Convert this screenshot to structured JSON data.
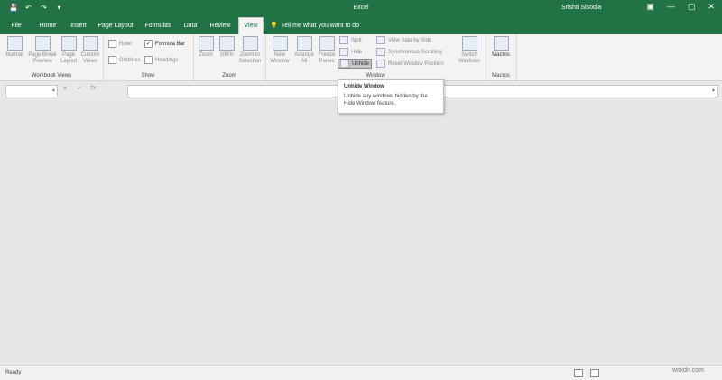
{
  "titlebar": {
    "title": "Excel",
    "user": "Srishti Sisodia",
    "qat": {
      "save": "💾",
      "undo": "↶",
      "redo": "↷",
      "more": "▾"
    },
    "window_buttons": {
      "ribbon_options": "▣",
      "minimize": "—",
      "maximize": "▢",
      "close": "✕"
    }
  },
  "tabs": [
    "File",
    "Home",
    "Insert",
    "Page Layout",
    "Formulas",
    "Data",
    "Review",
    "View"
  ],
  "tellme": "Tell me what you want to do",
  "ribbon": {
    "workbook_views": {
      "label": "Workbook Views",
      "buttons": [
        "Normal",
        "Page Break Preview",
        "Page Layout",
        "Custom Views"
      ]
    },
    "show": {
      "label": "Show",
      "ruler": "Ruler",
      "formula_bar": "Formula Bar",
      "gridlines": "Gridlines",
      "headings": "Headings",
      "formula_bar_checked": true
    },
    "zoom": {
      "label": "Zoom",
      "buttons": [
        "Zoom",
        "100%",
        "Zoom to Selection"
      ]
    },
    "window": {
      "label": "Window",
      "buttons": [
        "New Window",
        "Arrange All",
        "Freeze Panes"
      ],
      "split": "Split",
      "hide": "Hide",
      "unhide": "Unhide",
      "view_side_by_side": "View Side by Side",
      "synchronous_scrolling": "Synchronous Scrolling",
      "reset_window_position": "Reset Window Position",
      "switch_windows": "Switch Windows"
    },
    "macros": {
      "label": "Macros",
      "button": "Macros"
    }
  },
  "formula_bar": {
    "cancel": "✕",
    "enter": "✓",
    "fx": "fx"
  },
  "tooltip": {
    "title": "Unhide Window",
    "body": "Unhide any windows hidden by the Hide Window feature."
  },
  "status": {
    "ready": "Ready"
  },
  "watermark": "wsxdn.com",
  "colors": {
    "accent": "#217346"
  }
}
